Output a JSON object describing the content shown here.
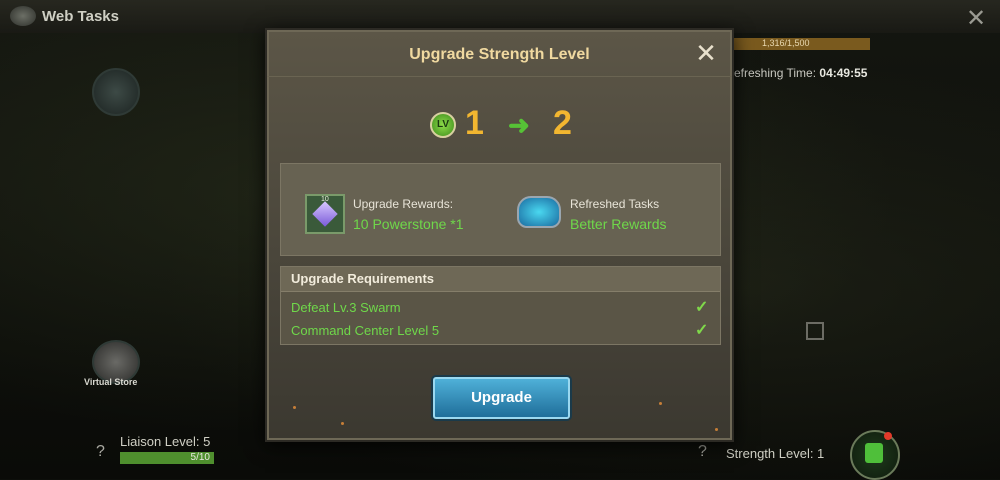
{
  "background": {
    "app_title": "Web Tasks",
    "progress_text": "1,316/1,500",
    "refresh_label": "efreshing Time:",
    "refresh_time": "04:49:55",
    "virtual_store_label": "Virtual Store",
    "liaison_level": "Liaison Level: 5",
    "liaison_progress": "5/10",
    "liaison_progress_fraction": 0.5,
    "strength_level": "Strength Level: 1",
    "help_glyph": "?"
  },
  "modal": {
    "title": "Upgrade Strength Level",
    "close_glyph": "✕",
    "level_badge": "LV",
    "level_from": "1",
    "level_arrow": "➜",
    "level_to": "2",
    "rewards": {
      "gem_count": "10",
      "upgrade_label": "Upgrade Rewards:",
      "upgrade_value": "10 Powerstone *1",
      "tasks_label": "Refreshed Tasks",
      "tasks_value": "Better Rewards"
    },
    "requirements": {
      "title": "Upgrade Requirements",
      "items": [
        {
          "label": "Defeat Lv.3 Swarm",
          "check": "✓"
        },
        {
          "label": "Command Center Level 5",
          "check": "✓"
        }
      ]
    },
    "upgrade_button": "Upgrade"
  },
  "colors": {
    "accent_gold": "#f2b630",
    "success_green": "#6fd84a",
    "button_blue": "#1f6e9a"
  }
}
